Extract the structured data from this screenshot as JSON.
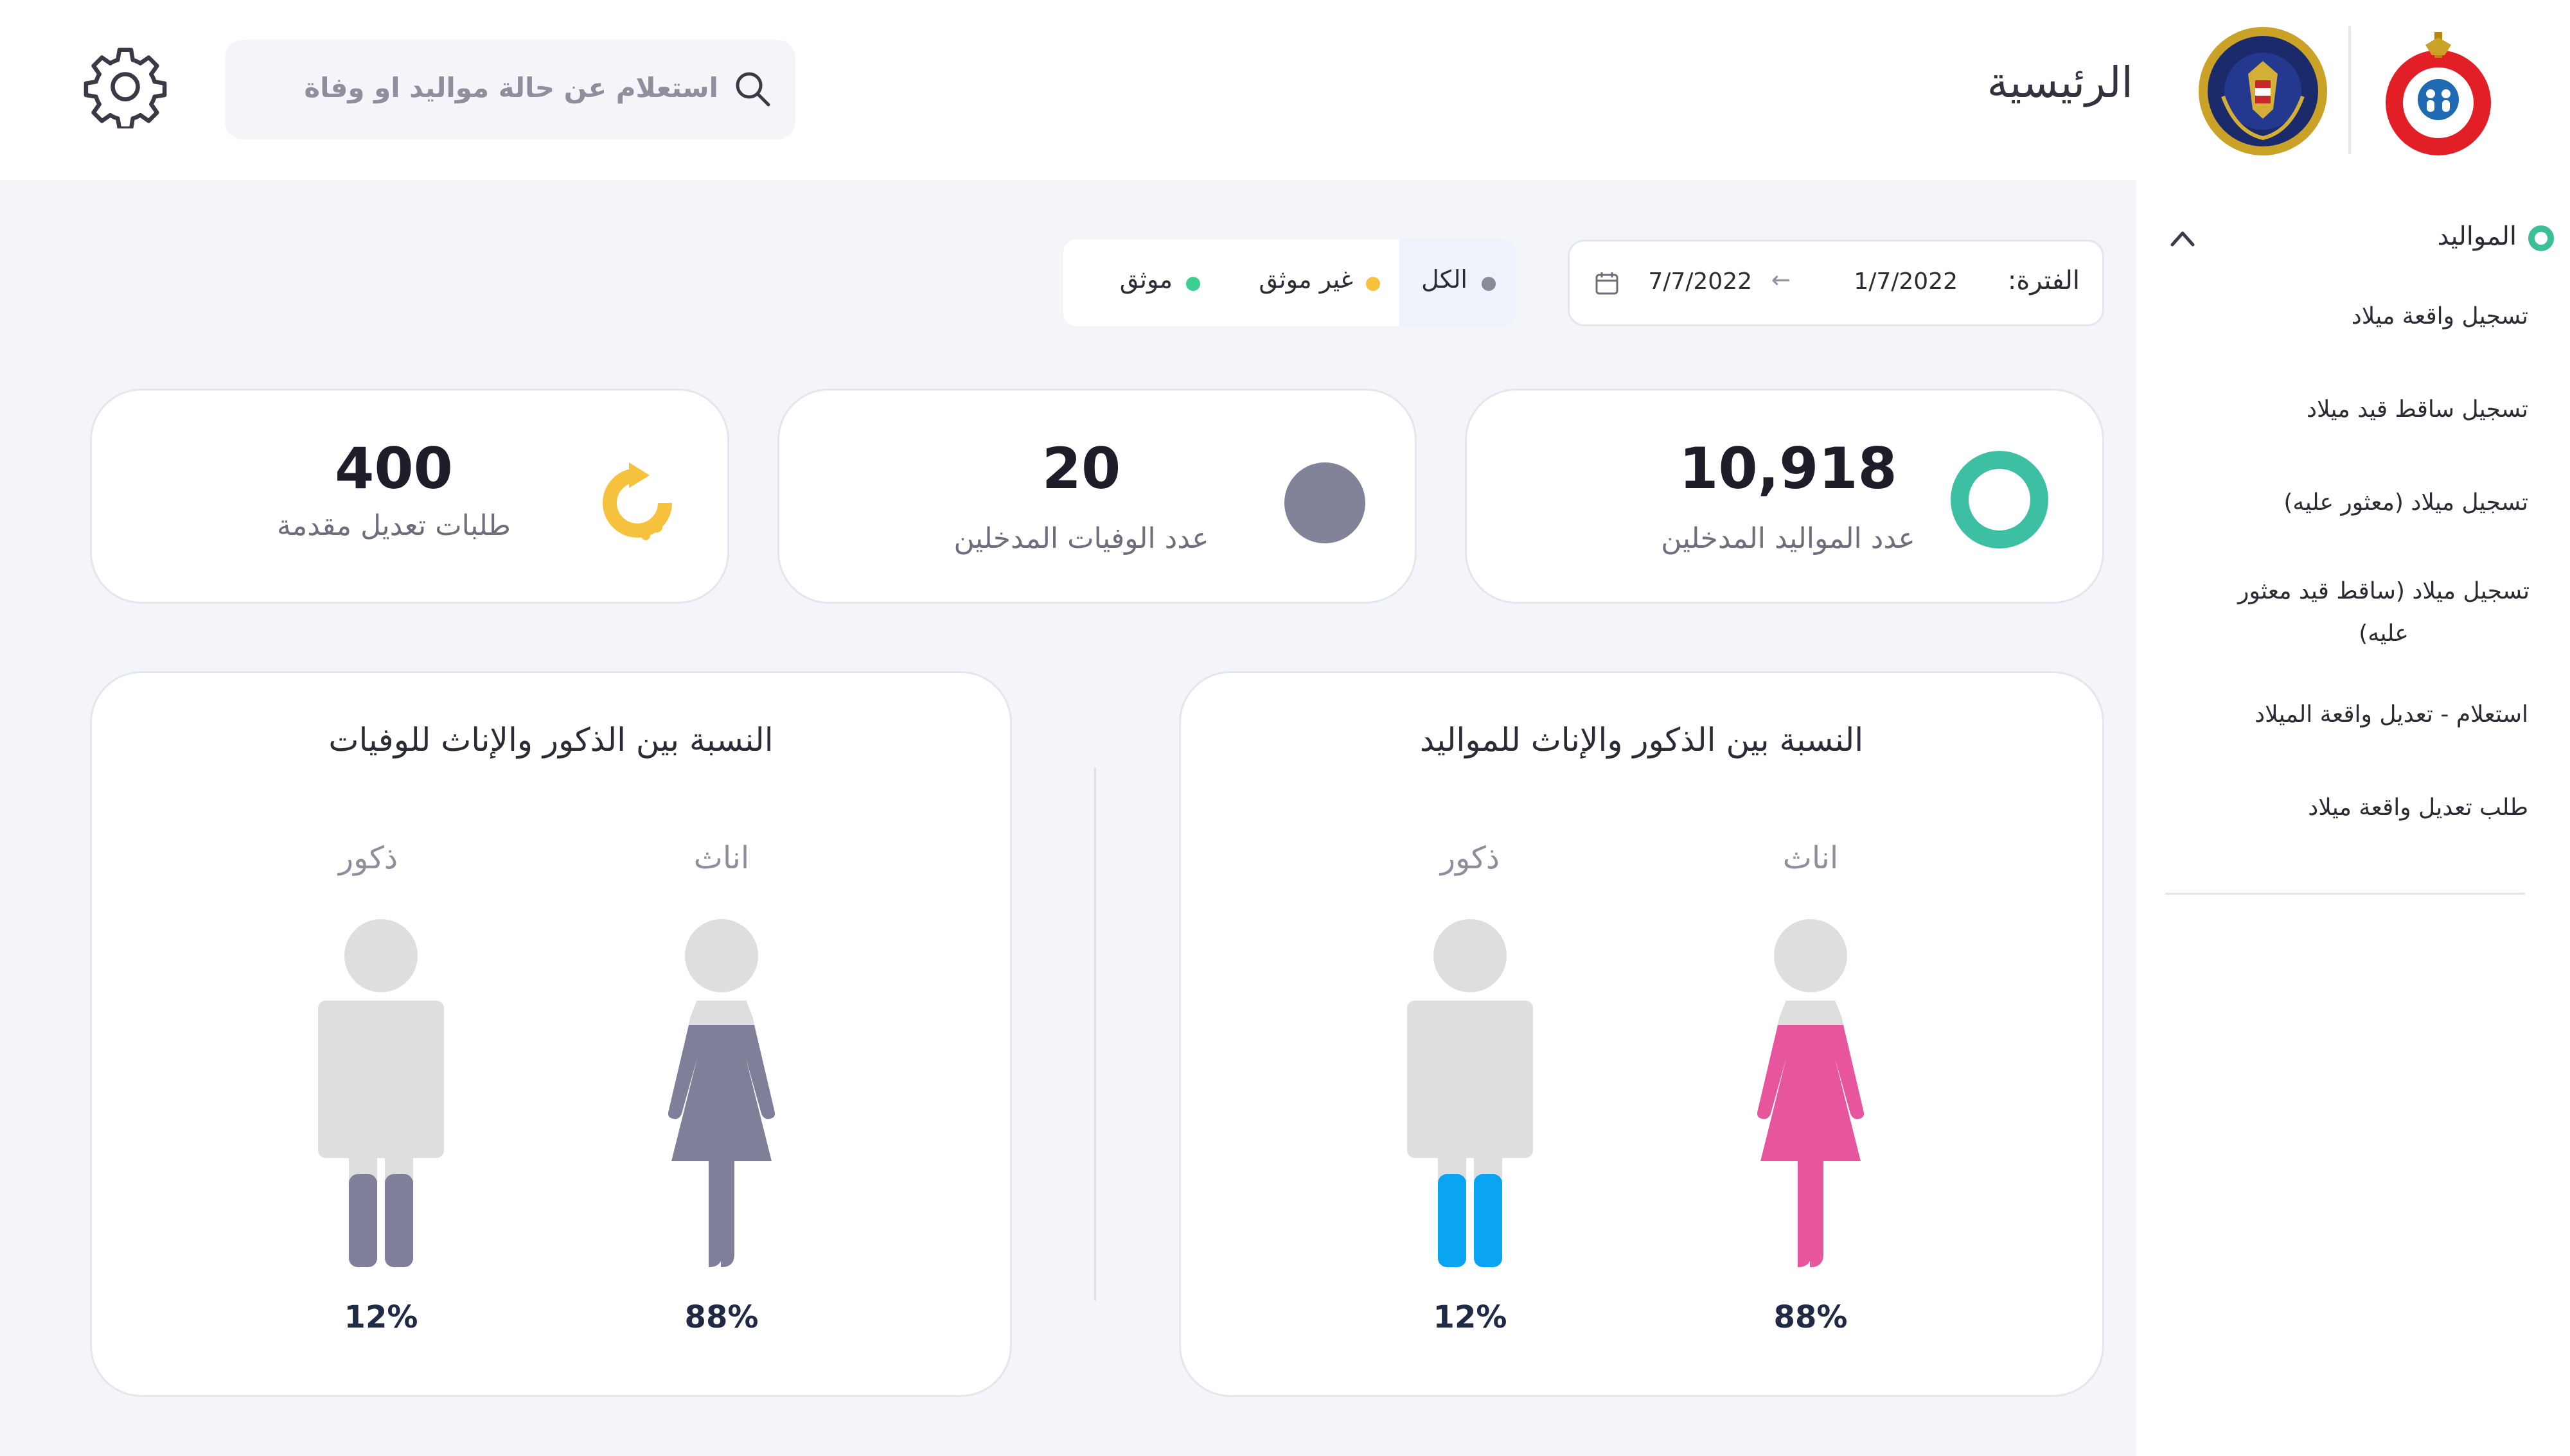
{
  "header": {
    "title": "الرئيسية",
    "search_placeholder": "استعلام عن حالة مواليد او وفاة",
    "icons": [
      "health-ministry-logo",
      "interior-ministry-logo",
      "search-icon",
      "gear-icon"
    ]
  },
  "sidebar": {
    "section_label": "المواليد",
    "items": [
      {
        "label": "تسجيل واقعة ميلاد"
      },
      {
        "label": "تسجيل ساقط قيد ميلاد"
      },
      {
        "label": "تسجيل ميلاد (معثور عليه)"
      },
      {
        "label": "تسجيل ميلاد (ساقط قيد معثور عليه)"
      },
      {
        "label": "استعلام - تعديل واقعة الميلاد"
      },
      {
        "label": "طلب تعديل واقعة ميلاد"
      }
    ]
  },
  "filters": {
    "period_label": "الفترة:",
    "from_date": "1/7/2022",
    "arrow": "←",
    "to_date": "7/7/2022",
    "status_options": [
      {
        "label": "الكل",
        "color": "#8a8a9a",
        "active": true
      },
      {
        "label": "غير موثق",
        "color": "#f6c23e",
        "active": false
      },
      {
        "label": "موثق",
        "color": "#3ccf91",
        "active": false
      }
    ]
  },
  "stats": [
    {
      "value": "10,918",
      "label": "عدد المواليد المدخلين",
      "icon": "ring-icon",
      "color": "#3cbfa3"
    },
    {
      "value": "20",
      "label": "عدد الوفيات المدخلين",
      "icon": "circle-icon",
      "color": "#828299"
    },
    {
      "value": "400",
      "label": "طلبات تعديل مقدمة",
      "icon": "refresh-icon",
      "color": "#f6c23e"
    }
  ],
  "ratios": [
    {
      "title": "النسبة بين الذكور والإناث للمواليد",
      "female_label": "اناث",
      "male_label": "ذكور",
      "female_pct": "88%",
      "male_pct": "12%",
      "female_color": "#e8559f",
      "male_color": "#0aa5f2"
    },
    {
      "title": "النسبة بين الذكور والإناث للوفيات",
      "female_label": "اناث",
      "male_label": "ذكور",
      "female_pct": "88%",
      "male_pct": "12%",
      "female_color": "#7f7f99",
      "male_color": "#7f7f99"
    }
  ],
  "colors": {
    "accent_green": "#3cbf99",
    "figure_base": "#dedede",
    "background": "#f3f5f9"
  }
}
